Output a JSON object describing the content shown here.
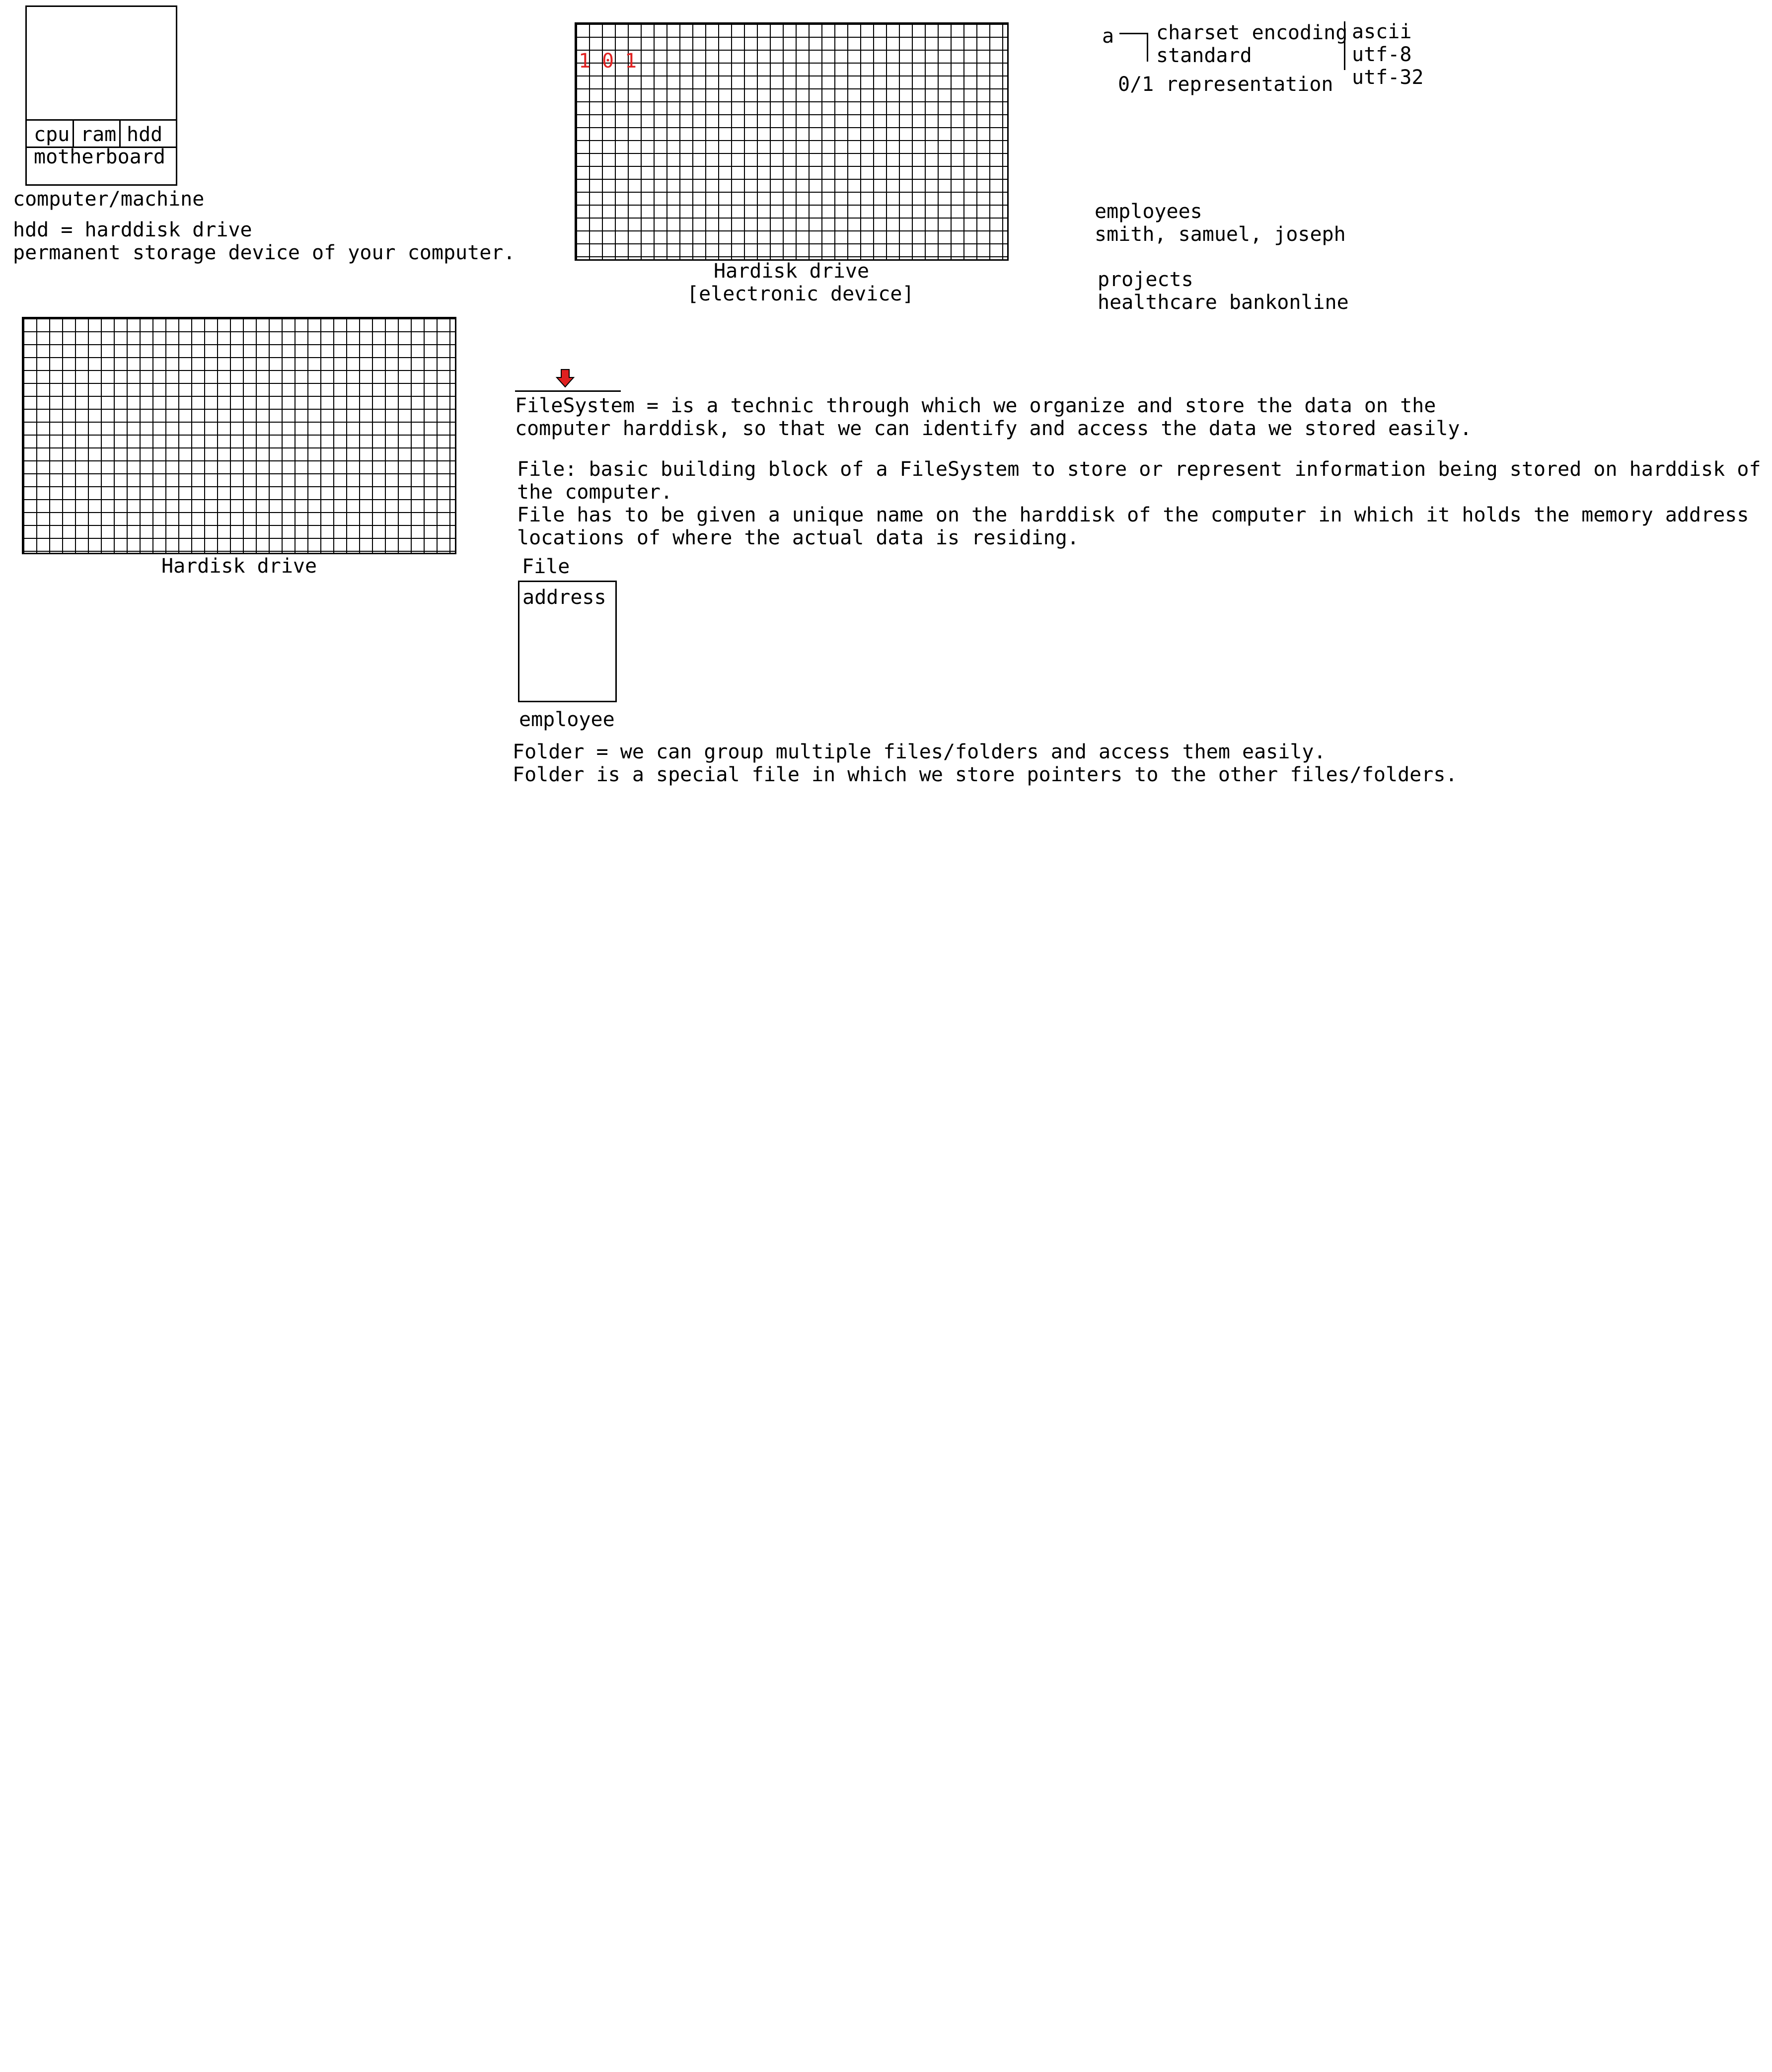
{
  "computer": {
    "parts": [
      "cpu",
      "ram",
      "hdd"
    ],
    "motherboard": "motherboard",
    "caption": "computer/machine"
  },
  "hdd_definition": {
    "line1": "hdd = harddisk drive",
    "line2": "permanent storage device of your computer."
  },
  "hdd_grid_left": {
    "caption": "Hardisk drive"
  },
  "hdd_grid_top": {
    "bits": [
      "1",
      "0",
      "1"
    ],
    "caption_line1": "Hardisk drive",
    "caption_line2": "[electronic device]",
    "bit_color": "#e02020"
  },
  "encoding": {
    "char": "a",
    "label_line1": "charset encoding",
    "label_line2": "standard",
    "representation": "0/1 representation",
    "standards": [
      "ascii",
      "utf-8",
      "utf-32"
    ]
  },
  "examples": {
    "employees_title": "employees",
    "employees_list": "smith, samuel, joseph",
    "projects_title": "projects",
    "projects_list": "healthcare bankonline"
  },
  "filesystem": {
    "marker_icon": "down-arrow-icon",
    "marker_color": "#e02020",
    "line1": "FileSystem = is a technic through which we organize and store the data on the",
    "line2": "computer harddisk, so that we can identify and access the data we stored easily."
  },
  "file_def": {
    "line1": "File: basic building block of a FileSystem to store or represent information being stored on harddisk of",
    "line2": "the computer.",
    "line3": "File has to be given a unique name on the harddisk of the computer in which it holds the memory address",
    "line4": "locations of where the actual data is residing."
  },
  "file_box": {
    "title": "File",
    "content": "address",
    "name": "employee"
  },
  "folder_def": {
    "line1": "Folder = we can group multiple files/folders and access them easily.",
    "line2": "Folder is a special file in which we store pointers to the other files/folders."
  }
}
